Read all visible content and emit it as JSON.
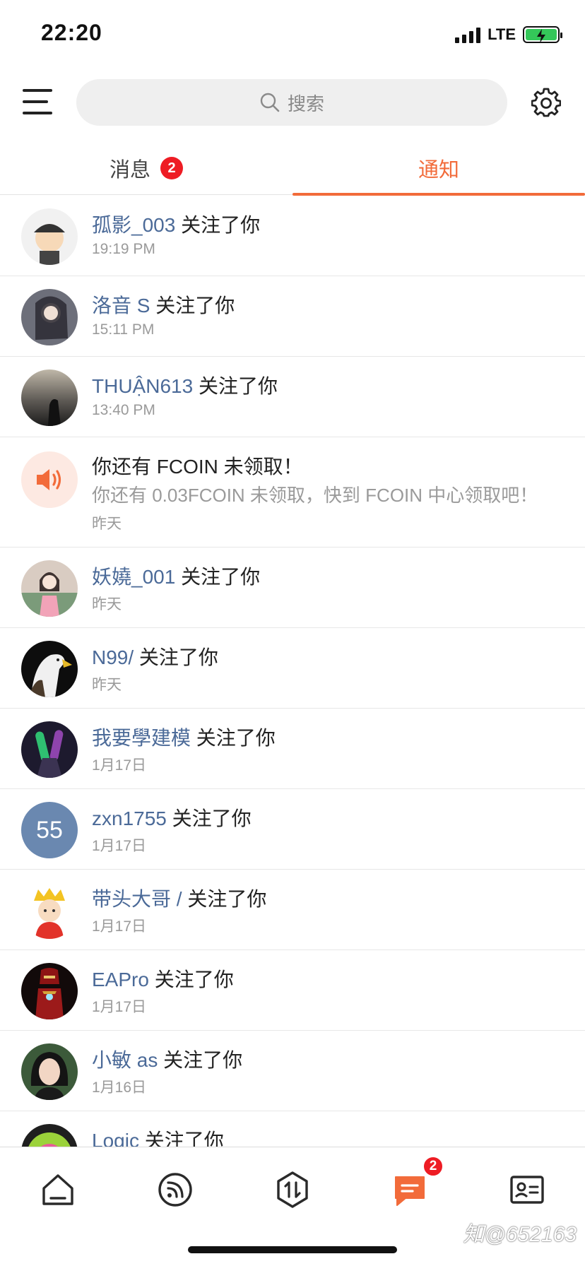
{
  "status": {
    "time": "22:20",
    "network": "LTE"
  },
  "header": {
    "search_placeholder": "搜索",
    "menu_icon": "hamburger-menu-icon",
    "settings_icon": "gear-icon"
  },
  "tabs": [
    {
      "label": "消息",
      "badge": "2",
      "active": false
    },
    {
      "label": "通知",
      "active": true
    }
  ],
  "accent_color": "#f26b3a",
  "username_color": "#4b6a98",
  "notifications": [
    {
      "user": "孤影_003",
      "action": " 关注了你",
      "time": "19:19 PM",
      "avatar": "cartoon-boy-avatar"
    },
    {
      "user": "洛音 S",
      "action": " 关注了你",
      "time": "15:11 PM",
      "avatar": "anime-girl-avatar"
    },
    {
      "user": "THUẬN613",
      "action": " 关注了你",
      "time": "13:40 PM",
      "avatar": "sunset-silhouette-avatar"
    },
    {
      "title": "你还有 FCOIN 未领取！",
      "subtitle": "你还有 0.03FCOIN 未领取，快到 FCOIN 中心领取吧！",
      "time": "昨天",
      "avatar": "speaker-icon"
    },
    {
      "user": "妖嬈_001",
      "action": " 关注了你",
      "time": "昨天",
      "avatar": "doll-avatar"
    },
    {
      "user": "N99/",
      "action": " 关注了你",
      "time": "昨天",
      "avatar": "eagle-avatar"
    },
    {
      "user": "我要學建模",
      "action": " 关注了你",
      "time": "1月17日",
      "avatar": "microphone-avatar"
    },
    {
      "user": "zxn1755",
      "action": " 关注了你",
      "time": "1月17日",
      "avatar_text": "55"
    },
    {
      "user": "带头大哥 /",
      "action": " 关注了你",
      "time": "1月17日",
      "avatar": "cartoon-king-avatar"
    },
    {
      "user": "EAPro",
      "action": " 关注了你",
      "time": "1月17日",
      "avatar": "iron-man-avatar"
    },
    {
      "user": "小敏 as",
      "action": " 关注了你",
      "time": "1月16日",
      "avatar": "woman-selfie-avatar"
    },
    {
      "user": "Logic",
      "action": " 关注了你",
      "time": "",
      "avatar": "colorful-logo-avatar"
    }
  ],
  "bottom_nav": [
    {
      "name": "home",
      "icon": "home-icon"
    },
    {
      "name": "feed",
      "icon": "rss-icon"
    },
    {
      "name": "trade",
      "icon": "swap-hexagon-icon"
    },
    {
      "name": "messages",
      "icon": "chat-bubble-icon",
      "badge": "2",
      "active": true
    },
    {
      "name": "profile",
      "icon": "id-card-icon"
    }
  ],
  "watermark": "知@652163"
}
